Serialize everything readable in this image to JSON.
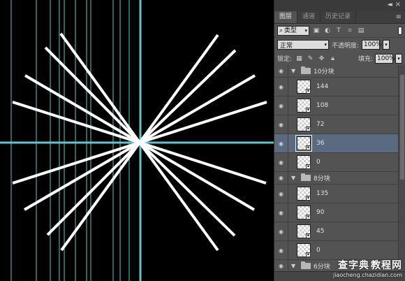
{
  "canvas": {
    "background": "#000000",
    "guide_color": "#5ec8c8",
    "line_color": "#ffffff"
  },
  "panel": {
    "tabs": [
      {
        "label": "图层",
        "active": true
      },
      {
        "label": "通道",
        "active": false
      },
      {
        "label": "历史记录",
        "active": false
      }
    ],
    "filter": {
      "label": "类型"
    },
    "blend_mode": "正常",
    "opacity_label": "不透明度:",
    "opacity_value": "100%",
    "lock_label": "锁定:",
    "fill_label": "填充:",
    "fill_value": "100%",
    "layers": [
      {
        "kind": "group",
        "name": "10分块"
      },
      {
        "kind": "layer",
        "name": "144"
      },
      {
        "kind": "layer",
        "name": "108"
      },
      {
        "kind": "layer",
        "name": "72"
      },
      {
        "kind": "layer",
        "name": "36",
        "selected": true
      },
      {
        "kind": "layer",
        "name": "0"
      },
      {
        "kind": "group",
        "name": "8分块"
      },
      {
        "kind": "layer",
        "name": "135"
      },
      {
        "kind": "layer",
        "name": "90"
      },
      {
        "kind": "layer",
        "name": "45"
      },
      {
        "kind": "layer",
        "name": "0"
      },
      {
        "kind": "group",
        "name": "6分块"
      }
    ],
    "selected_color": "#5a6a80"
  },
  "watermark": {
    "logo_left": "查字典",
    "logo_right": "教程网",
    "url": "jiaocheng.chazidian.com"
  }
}
